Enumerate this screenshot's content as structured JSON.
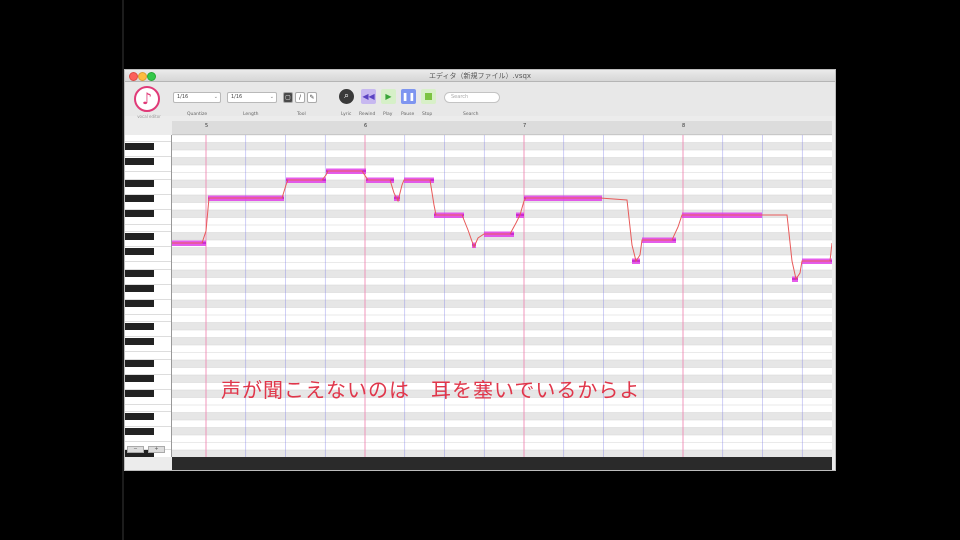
{
  "window": {
    "title": "エディタ（新規ファイル）.vsqx"
  },
  "logo": {
    "icon": "music-note-icon",
    "caption": "vocal editor"
  },
  "toolbar": {
    "quantize_value": "1/16",
    "length_value": "1/16",
    "tool_buttons": [
      "▢",
      "/",
      "✎"
    ],
    "search_placeholder": "Search",
    "column_labels": {
      "quantize": "Quantize",
      "length": "Length",
      "tool": "Tool",
      "lyric": "Lyric",
      "rewind": "Rewind",
      "play": "Play",
      "pause": "Pause",
      "stop": "Stop",
      "search": "Search"
    },
    "icons": {
      "zoom": "magnifier-icon",
      "rewind": "rewind-icon",
      "play": "play-icon",
      "pause": "pause-icon",
      "stop": "stop-icon"
    }
  },
  "ruler": {
    "bars": [
      "5",
      "6",
      "7",
      "8"
    ]
  },
  "zoom": {
    "out": "−",
    "in": "+"
  },
  "lyric": "声が聞こえないのは　耳を塞いでいるからよ",
  "colors": {
    "note": "#e040e8",
    "pitch_line": "#e85a5a",
    "bar_line": "#f08ab4",
    "beat_line": "#7a7ae8",
    "lyric": "#e0364a"
  }
}
